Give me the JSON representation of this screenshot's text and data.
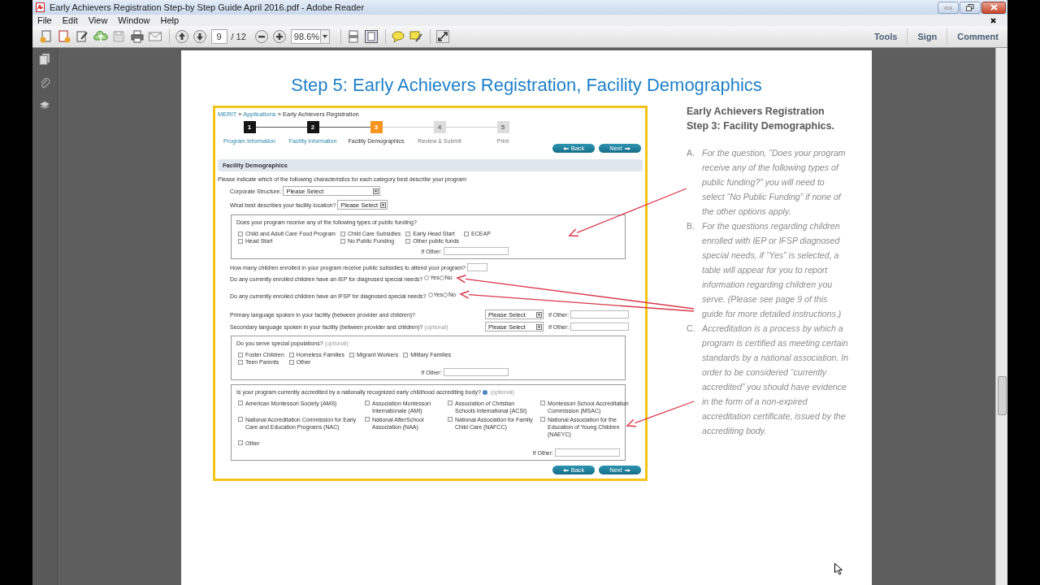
{
  "window": {
    "title": "Early Achievers Registration Step-by Step Guide April 2016.pdf - Adobe Reader"
  },
  "menu": [
    "File",
    "Edit",
    "View",
    "Window",
    "Help"
  ],
  "toolbar": {
    "page_number": "9",
    "page_total": "/ 12",
    "zoom": "98.6%",
    "panels": [
      "Tools",
      "Sign",
      "Comment"
    ]
  },
  "document": {
    "heading": "Step 5: Early Achievers Registration, Facility Demographics",
    "form": {
      "breadcrumb": [
        {
          "label": "MERIT",
          "link": true
        },
        {
          "label": "Applications",
          "link": true
        },
        {
          "label": "Early Achievers Registration",
          "link": false
        }
      ],
      "breadcrumb_separator": "»",
      "steps": [
        {
          "number": "1",
          "label": "Program Information",
          "completed": true,
          "selected": false
        },
        {
          "number": "2",
          "label": "Facility Information",
          "completed": true,
          "selected": false
        },
        {
          "number": "3",
          "label": "Facility Demographics",
          "completed": false,
          "selected": true
        },
        {
          "number": "4",
          "label": "Review & Submit",
          "completed": false,
          "selected": false
        },
        {
          "number": "5",
          "label": "Print",
          "completed": false,
          "selected": false
        }
      ],
      "nav_buttons_top": [
        {
          "label": "Back",
          "kind": "back"
        },
        {
          "label": "Next",
          "kind": "next"
        }
      ],
      "section_title": "Facility Demographics",
      "intro": "Please indicate which of the following characteristics for each category best describe your program",
      "fields": [
        {
          "kind": "select",
          "label": "Corporate Structure:",
          "value": "Please Select"
        },
        {
          "kind": "select",
          "label": "What best describes your facility location?",
          "value": "Please Select"
        },
        {
          "kind": "checkgroup",
          "question": "Does your program receive any of the following types of public funding?",
          "options": [
            {
              "label": "Child and Adult Care Food Program",
              "checked": false
            },
            {
              "label": "Child Care Subsidies",
              "checked": false
            },
            {
              "label": "Early Head Start",
              "checked": false
            },
            {
              "label": "ECEAP",
              "checked": false
            },
            {
              "label": "Head Start",
              "checked": false
            },
            {
              "label": "No Public Funding",
              "checked": false
            },
            {
              "label": "Other public funds",
              "checked": false
            }
          ],
          "other_label": "If Other:"
        },
        {
          "kind": "number",
          "label": "How many children enrolled in your program receive public subsidies to attend your program?"
        },
        {
          "kind": "yesno",
          "label": "Do any currently enrolled children have an IEP for diagnosed special needs?",
          "options": [
            {
              "label": "Yes",
              "selected": false
            },
            {
              "label": "No",
              "selected": false
            }
          ]
        },
        {
          "kind": "yesno",
          "label": "Do any currently enrolled children have an IFSP for diagnosed special needs?",
          "options": [
            {
              "label": "Yes",
              "selected": false
            },
            {
              "label": "No",
              "selected": false
            }
          ]
        },
        {
          "kind": "language",
          "label": "Primary language spoken in your facility (between provider and children)?",
          "value": "Please Select",
          "other_label": "If Other:"
        },
        {
          "kind": "language",
          "label": "Secondary language spoken in your facility (between provider and children)?",
          "note": "(optional)",
          "value": "Please Select",
          "other_label": "If Other:"
        },
        {
          "kind": "checkgroup",
          "question": "Do you serve special populations?",
          "note": "(optional)",
          "options": [
            {
              "label": "Foster Children",
              "checked": false
            },
            {
              "label": "Homeless Families",
              "checked": false
            },
            {
              "label": "Migrant Workers",
              "checked": false
            },
            {
              "label": "Military Families",
              "checked": false
            },
            {
              "label": "Teen Parents",
              "checked": false
            },
            {
              "label": "Other",
              "checked": false
            }
          ],
          "other_label": "If Other:"
        },
        {
          "kind": "accreditation",
          "question": "Is your program currently accredited by a nationally recognized early childhood accrediting body?",
          "note": "(optional)",
          "options": [
            {
              "label": "American Montessori Society (AMS)",
              "checked": false
            },
            {
              "label": "Association Montessori Internationale (AMI)",
              "checked": false
            },
            {
              "label": "Association of Christian Schools International (ACSI)",
              "checked": false
            },
            {
              "label": "Montessori School Accreditation Commission (MSAC)",
              "checked": false
            },
            {
              "label": "National Accreditation Commission for Early Care and Education Programs (NAC)",
              "checked": false
            },
            {
              "label": "National AfterSchool Association (NAA)",
              "checked": false
            },
            {
              "label": "National Association for Family Child Care (NAFCC)",
              "checked": false
            },
            {
              "label": "National Association for the Education of Young Children (NAEYC)",
              "checked": false
            },
            {
              "label": "Other",
              "checked": false
            }
          ],
          "other_label": "If Other:"
        }
      ],
      "nav_buttons_bottom": [
        {
          "label": "Back",
          "kind": "back"
        },
        {
          "label": "Next",
          "kind": "next"
        }
      ]
    },
    "notes": {
      "title": [
        "Early Achievers Registration",
        "Step 3: Facility Demographics."
      ],
      "items": [
        {
          "marker": "A.",
          "text": "For the question, “Does your program receive any of the following types of public funding?” you will need to select “No Public Funding” if none of the other options apply."
        },
        {
          "marker": "B.",
          "text": "For the questions regarding children enrolled with IEP or IFSP diagnosed special needs, if “Yes” is selected, a table will appear for you to report information regarding children you serve. (Please see page 9 of this guide for more detailed instructions.)"
        },
        {
          "marker": "C.",
          "text": "Accreditation is a process by which a program is certified as meeting certain standards by a national association. In order to be considered “currently accredited” you should have evidence in the form of a non-expired accreditation certificate, issued by the accrediting body."
        }
      ]
    }
  }
}
